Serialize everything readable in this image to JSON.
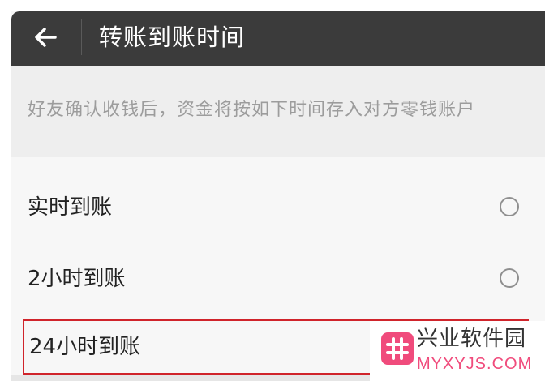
{
  "header": {
    "title": "转账到账时间",
    "back_icon": "arrow-left-icon"
  },
  "notice": {
    "text": "好友确认收钱后，资金将按如下时间存入对方零钱账户"
  },
  "options": [
    {
      "label": "实时到账",
      "selected": false,
      "highlighted": false
    },
    {
      "label": "2小时到账",
      "selected": false,
      "highlighted": false
    },
    {
      "label": "24小时到账",
      "selected": false,
      "highlighted": true
    }
  ],
  "watermark": {
    "title": "兴业软件园",
    "url": "MYXYJS.COM",
    "brand_color": "#f04b7c"
  },
  "colors": {
    "header_bg": "#3b3b3b",
    "notice_bg": "#eeeeee",
    "highlight_border": "#d0242b"
  }
}
